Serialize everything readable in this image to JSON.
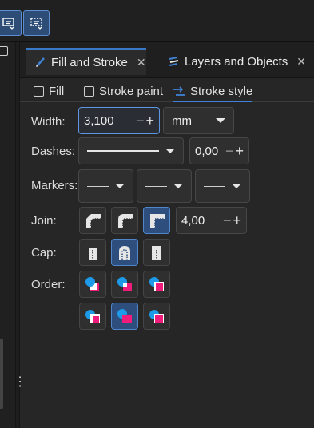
{
  "toolbar": {
    "buttons": [
      "dock-panel-icon",
      "dock-panel-alt-icon"
    ]
  },
  "dock": {
    "tabs": [
      {
        "label": "Fill and Stroke",
        "icon": "fill-stroke-icon",
        "close": "✕"
      },
      {
        "label": "Layers and Objects",
        "icon": "layers-icon",
        "close": "✕"
      }
    ]
  },
  "subtabs": [
    {
      "label": "Fill",
      "icon": "checkbox"
    },
    {
      "label": "Stroke paint",
      "icon": "checkbox"
    },
    {
      "label": "Stroke style",
      "icon": "stroke-style-icon",
      "active": true
    }
  ],
  "rows": {
    "width": {
      "label": "Width:",
      "value": "3,100",
      "unit": "mm"
    },
    "dashes": {
      "label": "Dashes:",
      "offset": "0,00"
    },
    "markers": {
      "label": "Markers:"
    },
    "join": {
      "label": "Join:",
      "miter": "4,00",
      "options": [
        "bevel-join-icon",
        "round-join-icon",
        "miter-join-icon"
      ],
      "selected": 2
    },
    "cap": {
      "label": "Cap:",
      "options": [
        "butt-cap-icon",
        "round-cap-icon",
        "square-cap-icon"
      ],
      "selected": 1
    },
    "order": {
      "label": "Order:"
    }
  },
  "colors": {
    "accent": "#3f82d6",
    "selected_bg": "#2e4f7e",
    "blue": "#1e9be8",
    "pink": "#f01c7c"
  }
}
